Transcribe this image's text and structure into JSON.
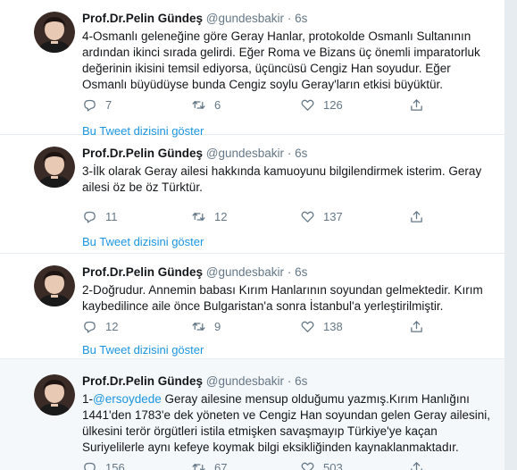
{
  "tweets": [
    {
      "name": "Prof.Dr.Pelin Gündeş",
      "handle": "@gundesbakir",
      "dot": "·",
      "time": "6s",
      "text_parts": [
        {
          "text": "4-Osmanlı geleneğine göre Geray Hanlar, protokolde Osmanlı Sultanının ardından ikinci sırada gelirdi. Eğer Roma ve Bizans üç önemli imparatorluk değerinin ikisini temsil ediyorsa, üçüncüsü Cengiz Han soyudur. Eğer Osmanlı büyüdüyse bunda Cengiz soylu Geray'ların etkisi büyüktür.",
          "mention": false
        }
      ],
      "replies": "7",
      "retweets": "6",
      "likes": "126",
      "thread_link": "Bu Tweet dizisini göster"
    },
    {
      "name": "Prof.Dr.Pelin Gündeş",
      "handle": "@gundesbakir",
      "dot": "·",
      "time": "6s",
      "text_parts": [
        {
          "text": "3-İlk olarak Geray ailesi hakkında kamuoyunu bilgilendirmek isterim. Geray ailesi öz be öz Türktür.",
          "mention": false
        }
      ],
      "replies": "11",
      "retweets": "12",
      "likes": "137",
      "thread_link": "Bu Tweet dizisini göster"
    },
    {
      "name": "Prof.Dr.Pelin Gündeş",
      "handle": "@gundesbakir",
      "dot": "·",
      "time": "6s",
      "text_parts": [
        {
          "text": "2-Doğrudur. Annemin babası Kırım Hanlarının soyundan gelmektedir. Kırım kaybedilince aile önce Bulgaristan'a sonra İstanbul'a yerleştirilmiştir.",
          "mention": false
        }
      ],
      "replies": "12",
      "retweets": "9",
      "likes": "138",
      "thread_link": "Bu Tweet dizisini göster"
    },
    {
      "name": "Prof.Dr.Pelin Gündeş",
      "handle": "@gundesbakir",
      "dot": "·",
      "time": "6s",
      "text_parts": [
        {
          "text": "1-",
          "mention": false
        },
        {
          "text": "@ersoydede",
          "mention": true
        },
        {
          "text": " Geray ailesine mensup olduğumu yazmış.Kırım Hanlığını 1441'den 1783'e dek yöneten ve Cengiz Han soyundan gelen Geray ailesini, ülkesini terör örgütleri istila etmişken savaşmayıp Türkiye'ye kaçan Suriyelilerle aynı kefeye koymak bilgi eksikliğinden kaynaklanmaktadır.",
          "mention": false
        }
      ],
      "replies": "156",
      "retweets": "67",
      "likes": "503",
      "thread_link": ""
    }
  ],
  "colors": {
    "text": "#14171a",
    "secondary": "#657786",
    "link": "#1b95e0",
    "divider": "#e6ecf0"
  },
  "icons": {
    "reply": "reply-icon",
    "retweet": "retweet-icon",
    "like": "like-icon",
    "share": "share-icon"
  }
}
